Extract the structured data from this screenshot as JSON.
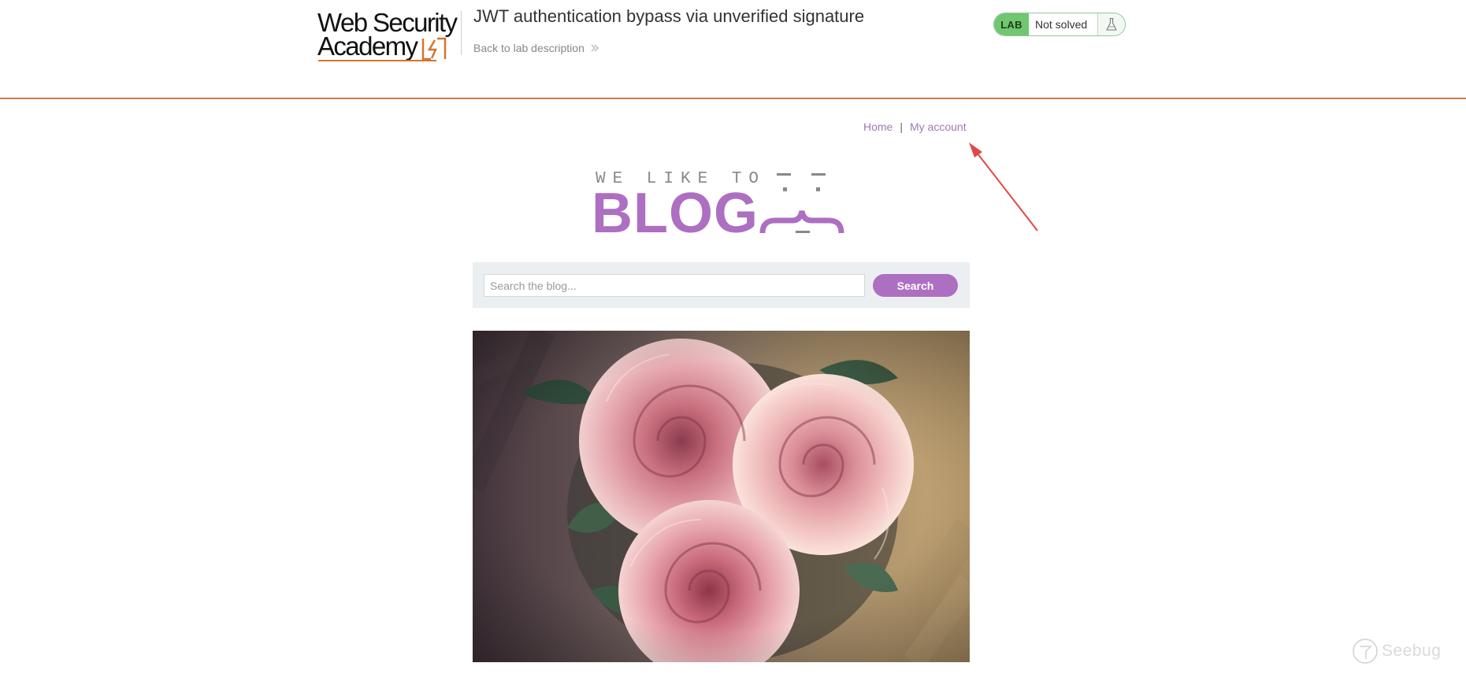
{
  "lab_header": {
    "logo_line1": "Web Security",
    "logo_line2": "Academy",
    "title": "JWT authentication bypass via unverified signature",
    "back_link": "Back to lab description",
    "status_badge": "LAB",
    "status_text": "Not solved",
    "status_icon": "flask-icon",
    "colors": {
      "accent": "#c97d4e",
      "lab_badge": "#70c76f"
    }
  },
  "nav": {
    "home": "Home",
    "separator": "|",
    "my_account": "My account"
  },
  "banner": {
    "tagline": "WE LIKE TO",
    "word": "BLOG",
    "color": "#ad6fc1"
  },
  "search": {
    "placeholder": "Search the blog...",
    "button_label": "Search"
  },
  "post": {
    "image": "roses-photo"
  },
  "watermark": {
    "text": "Seebug"
  }
}
